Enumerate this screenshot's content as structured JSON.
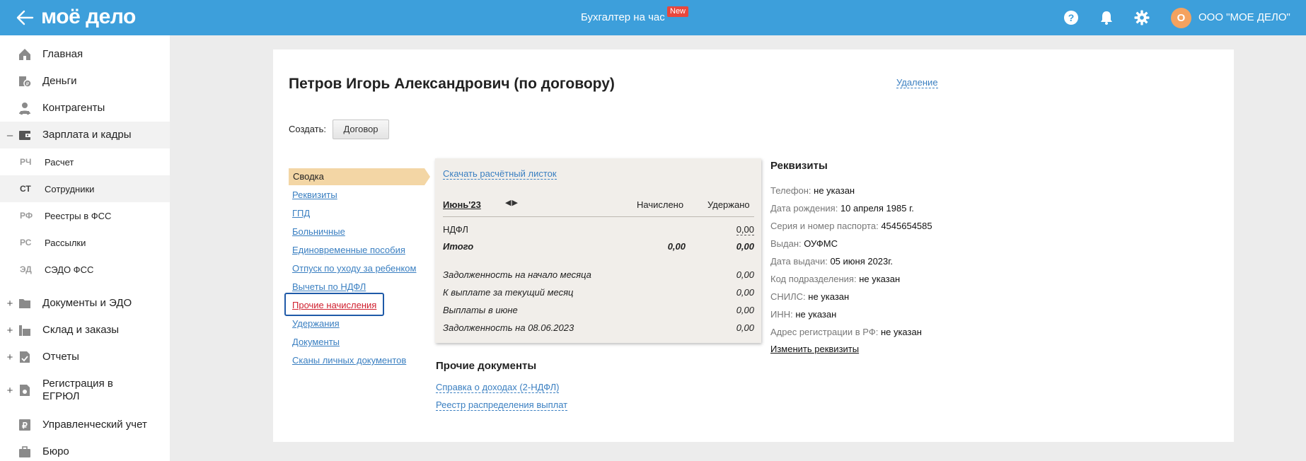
{
  "topbar": {
    "logo": "моё дело",
    "center_link": "Бухгалтер на час",
    "new_badge": "New",
    "user_initial": "О",
    "user_name": "ООО \"МОЕ ДЕЛО\""
  },
  "sidebar": {
    "items": [
      {
        "label": "Главная",
        "icon": "home-icon"
      },
      {
        "label": "Деньги",
        "icon": "money-icon"
      },
      {
        "label": "Контрагенты",
        "icon": "contractors-icon"
      },
      {
        "label": "Зарплата и кадры",
        "icon": "wallet-icon",
        "expander": "–"
      }
    ],
    "subitems": [
      {
        "abbr": "РЧ",
        "label": "Расчет"
      },
      {
        "abbr": "СТ",
        "label": "Сотрудники"
      },
      {
        "abbr": "РФ",
        "label": "Реестры в ФСС"
      },
      {
        "abbr": "РС",
        "label": "Рассылки"
      },
      {
        "abbr": "ЭД",
        "label": "СЭДО ФСС"
      }
    ],
    "items2": [
      {
        "label": "Документы и ЭДО",
        "icon": "folder-icon",
        "expander": "+"
      },
      {
        "label": "Склад и заказы",
        "icon": "warehouse-icon",
        "expander": "+"
      },
      {
        "label": "Отчеты",
        "icon": "report-icon",
        "expander": "+"
      },
      {
        "label": "Регистрация в ЕГРЮЛ",
        "icon": "registration-icon",
        "expander": "+"
      },
      {
        "label": "Управленческий учет",
        "icon": "ruble-doc-icon"
      },
      {
        "label": "Бюро",
        "icon": "briefcase-icon"
      }
    ]
  },
  "main": {
    "title": "Петров Игорь Александрович (по договору)",
    "delete_link": "Удаление",
    "create_label": "Создать:",
    "create_button": "Договор",
    "nav": [
      "Сводка",
      "Реквизиты",
      "ГПД",
      "Больничные",
      "Единовременные пособия",
      "Отпуск по уходу за ребенком",
      "Вычеты по НДФЛ",
      "Прочие начисления",
      "Удержания",
      "Документы",
      "Сканы личных документов"
    ]
  },
  "paysheet": {
    "download_link": "Скачать расчётный листок",
    "month": "Июнь'23",
    "arrows": "◀▶",
    "col_accrued": "Начислено",
    "col_withheld": "Удержано",
    "rows": [
      {
        "name": "НДФЛ",
        "accrued": "",
        "withheld": "0,00"
      },
      {
        "name": "Итого",
        "accrued": "0,00",
        "withheld": "0,00"
      },
      {
        "name": "Задолженность на начало месяца",
        "accrued": "",
        "withheld": "0,00"
      },
      {
        "name": "К выплате за текущий месяц",
        "accrued": "",
        "withheld": "0,00"
      },
      {
        "name": "Выплаты в июне",
        "accrued": "",
        "withheld": "0,00"
      },
      {
        "name": "Задолженность на 08.06.2023",
        "accrued": "",
        "withheld": "0,00"
      }
    ]
  },
  "other_docs": {
    "title": "Прочие документы",
    "links": [
      "Справка о доходах (2-НДФЛ)",
      "Реестр распределения выплат"
    ]
  },
  "requisites": {
    "title": "Реквизиты",
    "rows": [
      {
        "key": "Телефон: ",
        "value": "не указан"
      },
      {
        "key": "Дата рождения: ",
        "value": "10 апреля 1985 г."
      },
      {
        "key": "Серия и номер паспорта: ",
        "value": "4545654585"
      },
      {
        "key": "Выдан: ",
        "value": "ОУФМС"
      },
      {
        "key": "Дата выдачи: ",
        "value": "05 июня 2023г."
      },
      {
        "key": "Код подразделения: ",
        "value": "не указан"
      },
      {
        "key": "СНИЛС: ",
        "value": "не указан"
      },
      {
        "key": "ИНН: ",
        "value": "не указан"
      },
      {
        "key": "Адрес регистрации в РФ: ",
        "value": "не указан"
      }
    ],
    "edit_link": "Изменить реквизиты"
  },
  "colors": {
    "topbar": "#3d9fdb",
    "link": "#3a7fc1",
    "active_link": "#d0202f",
    "summary_tab": "#f3d6a5",
    "highlight_box": "#1f5aa8"
  }
}
